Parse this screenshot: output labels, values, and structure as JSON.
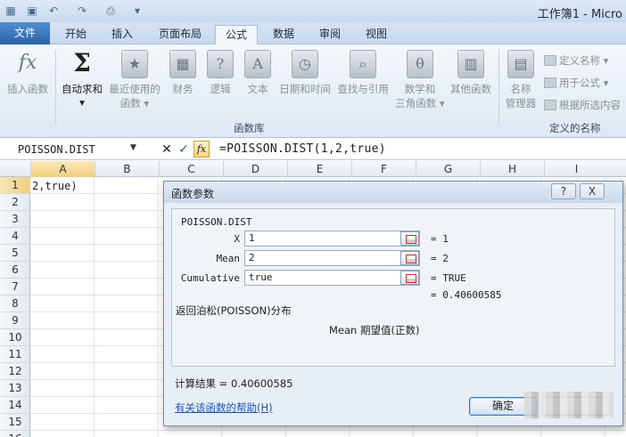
{
  "window": {
    "title": "工作簿1 - Micro"
  },
  "tabs": [
    {
      "label": "文件"
    },
    {
      "label": "开始"
    },
    {
      "label": "插入"
    },
    {
      "label": "页面布局"
    },
    {
      "label": "公式"
    },
    {
      "label": "数据"
    },
    {
      "label": "审阅"
    },
    {
      "label": "视图"
    }
  ],
  "ribbon": {
    "insert_function": "插入函数",
    "autosum": "自动求和",
    "autosum_arrow": "▾",
    "recent": [
      "最近使用的",
      "函数 ▾"
    ],
    "financial": "财务",
    "logical": "逻辑",
    "text": "文本",
    "datetime": "日期和时间",
    "lookup": "查找与引用",
    "math": [
      "数学和",
      "三角函数 ▾"
    ],
    "more": "其他函数",
    "library_group": "函数库",
    "name_manager": [
      "名称",
      "管理器"
    ],
    "define_name": "定义名称 ▾",
    "use_in_formula": "用于公式 ▾",
    "create_from_selection": "根据所选内容",
    "names_group": "定义的名称"
  },
  "formula_bar": {
    "name_box": "POISSON.DIST",
    "cancel": "✕",
    "enter": "✓",
    "fx": "fx",
    "formula": "=POISSON.DIST(1,2,true)"
  },
  "grid": {
    "columns": [
      "A",
      "B",
      "C",
      "D",
      "E",
      "F",
      "G",
      "H",
      "I"
    ],
    "rows": [
      "1",
      "2",
      "3",
      "4",
      "5",
      "6",
      "7",
      "8",
      "9",
      "10",
      "11",
      "12",
      "13",
      "14",
      "15",
      "16"
    ],
    "cell_a1": "2,true)"
  },
  "dialog": {
    "title": "函数参数",
    "help_btn": "?",
    "close_btn": "X",
    "function_name": "POISSON.DIST",
    "args": [
      {
        "label": "X",
        "value": "1",
        "result": "=  1"
      },
      {
        "label": "Mean",
        "value": "2",
        "result": "=  2"
      },
      {
        "label": "Cumulative",
        "value": "true",
        "result": "=  TRUE"
      }
    ],
    "formula_result": "=  0.40600585",
    "description": "返回泊松(POISSON)分布",
    "arg_description": "Mean  期望值(正数)",
    "calc_result": "计算结果 =  0.40600585",
    "help_link": "有关该函数的帮助(H)",
    "ok": "确定",
    "cancel": ""
  }
}
